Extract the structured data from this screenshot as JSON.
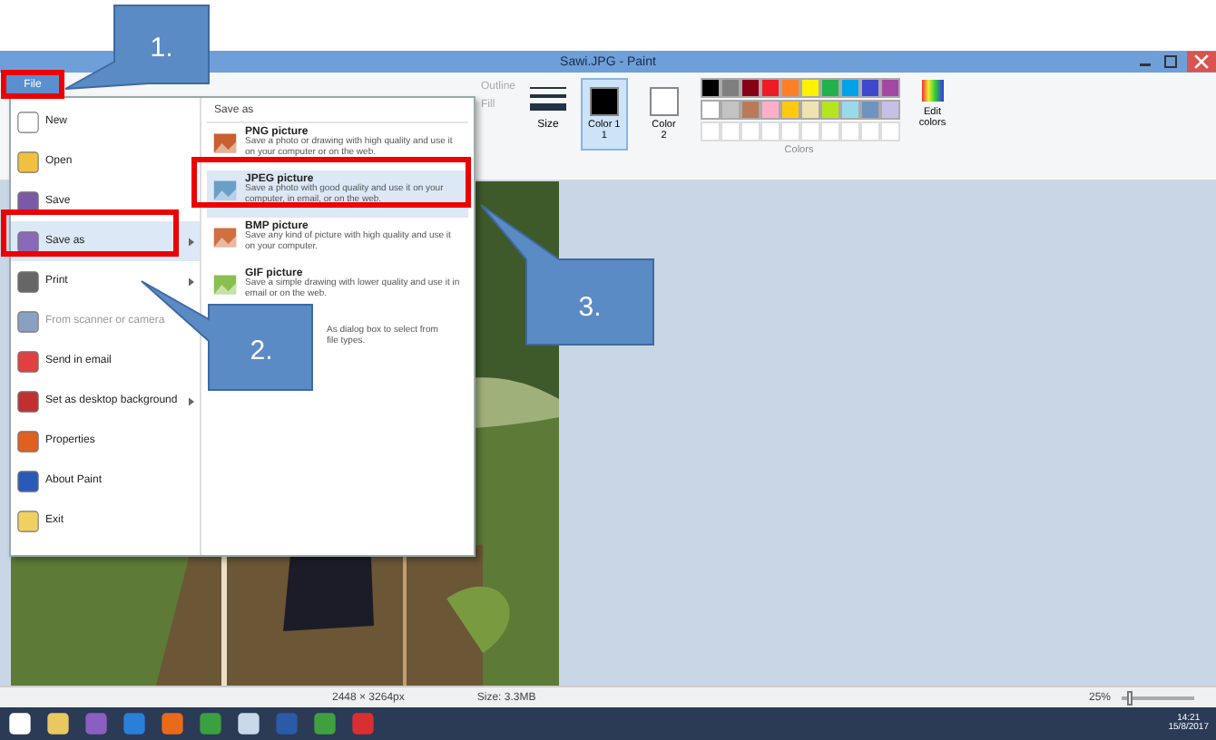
{
  "window": {
    "title": "Sawi.JPG - Paint"
  },
  "file_button": {
    "label": "File",
    "selected": true
  },
  "file_menu": {
    "items": [
      {
        "label": "New",
        "has_submenu": false,
        "disabled": false,
        "selected": false
      },
      {
        "label": "Open",
        "has_submenu": false,
        "disabled": false,
        "selected": false
      },
      {
        "label": "Save",
        "has_submenu": false,
        "disabled": false,
        "selected": false
      },
      {
        "label": "Save as",
        "has_submenu": true,
        "disabled": false,
        "selected": true
      },
      {
        "label": "Print",
        "has_submenu": true,
        "disabled": false,
        "selected": false
      },
      {
        "label": "From scanner or camera",
        "has_submenu": false,
        "disabled": true,
        "selected": false
      },
      {
        "label": "Send in email",
        "has_submenu": false,
        "disabled": false,
        "selected": false
      },
      {
        "label": "Set as desktop background",
        "has_submenu": true,
        "disabled": false,
        "selected": false
      },
      {
        "label": "Properties",
        "has_submenu": false,
        "disabled": false,
        "selected": false
      },
      {
        "label": "About Paint",
        "has_submenu": false,
        "disabled": false,
        "selected": false
      },
      {
        "label": "Exit",
        "has_submenu": false,
        "disabled": false,
        "selected": false
      }
    ],
    "panel": {
      "heading": "Save as",
      "options": [
        {
          "kind": "format",
          "title": "PNG picture",
          "description": "Save a photo or drawing with high quality and use it on your computer or on the web.",
          "selected": false
        },
        {
          "kind": "format",
          "title": "JPEG picture",
          "description": "Save a photo with good quality and use it on your computer, in email, or on the web.",
          "selected": true
        },
        {
          "kind": "format",
          "title": "BMP picture",
          "description": "Save any kind of picture with high quality and use it on your computer.",
          "selected": false
        },
        {
          "kind": "format",
          "title": "GIF picture",
          "description": "Save a simple drawing with lower quality and use it in email or on the web.",
          "selected": false
        },
        {
          "kind": "covered",
          "lines": [
            "As dialog box to select from",
            "file types."
          ],
          "selected": false
        }
      ]
    }
  },
  "ribbon": {
    "tools": [
      {
        "label": "Outline",
        "disabled": true
      },
      {
        "label": "Fill",
        "disabled": true
      }
    ],
    "size": "Size",
    "color_slots": [
      {
        "label": "Color 1",
        "number": "1",
        "selected": true,
        "color": "#000000"
      },
      {
        "label": "Color",
        "number": "2",
        "selected": false,
        "color": "#ffffff"
      }
    ],
    "palette": [
      {
        "color": "#000000"
      },
      {
        "color": "#7f7f7f"
      },
      {
        "color": "#880015"
      },
      {
        "color": "#ed1c24"
      },
      {
        "color": "#ff7f27"
      },
      {
        "color": "#fff200"
      },
      {
        "color": "#22b14c"
      },
      {
        "color": "#00a2e8"
      },
      {
        "color": "#3f48cc"
      },
      {
        "color": "#a349a4"
      },
      {
        "color": "#ffffff"
      },
      {
        "color": "#c3c3c3"
      },
      {
        "color": "#b97a57"
      },
      {
        "color": "#ffaec9"
      },
      {
        "color": "#ffc90e"
      },
      {
        "color": "#efe4b0"
      },
      {
        "color": "#b5e61d"
      },
      {
        "color": "#99d9ea"
      },
      {
        "color": "#7092be"
      },
      {
        "color": "#c8bfe7"
      }
    ],
    "edit_colors": "Edit colors",
    "group_label": "Colors"
  },
  "status_bar": {
    "dimensions": "2448 × 3264px",
    "file_size": "Size: 3.3MB",
    "zoom": "25%",
    "level": 0.08
  },
  "taskbar": {
    "time": "14:21",
    "date": "15/8/2017"
  },
  "callouts": [
    {
      "label": "1."
    },
    {
      "label": "2."
    },
    {
      "label": "3."
    }
  ]
}
